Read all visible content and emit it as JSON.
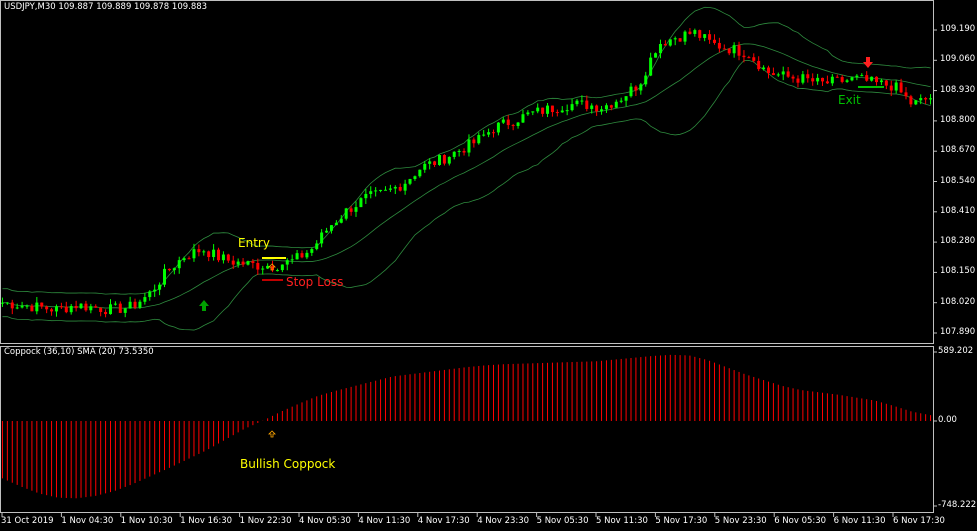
{
  "header": {
    "symbol_info": "USDJPY,M30  109.887 109.889 109.878 109.883"
  },
  "indicator": {
    "title": "Coppock (36,10) SMA (20)  73.5350"
  },
  "colors": {
    "bull": "#00ff00",
    "bear": "#ff0000",
    "bands": "#2e8b3e",
    "coppock": "#ff0000",
    "axis": "#c0c0c0"
  },
  "annotations": {
    "entry": "Entry",
    "stop_loss": "Stop Loss",
    "exit": "Exit",
    "bullish_coppock": "Bullish Coppock"
  },
  "chart_data": [
    {
      "type": "candlestick",
      "title": "USDJPY,M30",
      "y_ticks": [
        "109.190",
        "109.060",
        "108.930",
        "108.800",
        "108.670",
        "108.540",
        "108.410",
        "108.280",
        "108.150",
        "108.020",
        "107.890"
      ],
      "ylim": [
        107.87,
        109.31
      ],
      "x_ticks": [
        "31 Oct 2019",
        "1 Nov 04:30",
        "1 Nov 10:30",
        "1 Nov 16:30",
        "1 Nov 22:30",
        "4 Nov 05:30",
        "4 Nov 11:30",
        "4 Nov 17:30",
        "4 Nov 23:30",
        "5 Nov 05:30",
        "5 Nov 11:30",
        "5 Nov 17:30",
        "5 Nov 23:30",
        "6 Nov 05:30",
        "6 Nov 11:30",
        "6 Nov 17:30"
      ],
      "closes": [
        108.02,
        108.01,
        108.0,
        107.99,
        108.01,
        108.0,
        107.99,
        108.0,
        108.05,
        108.15,
        108.22,
        108.25,
        108.21,
        108.19,
        108.18,
        108.18,
        108.2,
        108.25,
        108.35,
        108.42,
        108.47,
        108.49,
        108.53,
        108.6,
        108.63,
        108.67,
        108.71,
        108.77,
        108.8,
        108.83,
        108.85,
        108.87,
        108.87,
        108.86,
        108.9,
        108.96,
        109.13,
        109.16,
        109.18,
        109.13,
        109.11,
        109.09,
        109.01,
        108.99,
        108.98,
        108.96,
        108.97,
        108.98,
        108.96,
        108.95,
        108.87,
        108.9
      ],
      "indicator": "Bollinger Bands"
    },
    {
      "type": "histogram",
      "title": "Coppock (36,10) SMA (20)",
      "y_ticks": [
        "589.202",
        "0.00",
        "-748.222"
      ],
      "ylim": [
        -748.222,
        589.202
      ],
      "values": [
        -490,
        -560,
        -620,
        -655,
        -660,
        -640,
        -600,
        -540,
        -470,
        -400,
        -325,
        -250,
        -160,
        -70,
        0,
        80,
        150,
        215,
        260,
        300,
        340,
        380,
        400,
        420,
        440,
        460,
        475,
        485,
        490,
        495,
        500,
        505,
        510,
        525,
        540,
        555,
        565,
        560,
        520,
        460,
        400,
        350,
        300,
        265,
        245,
        225,
        200,
        175,
        130,
        80,
        50
      ]
    }
  ]
}
